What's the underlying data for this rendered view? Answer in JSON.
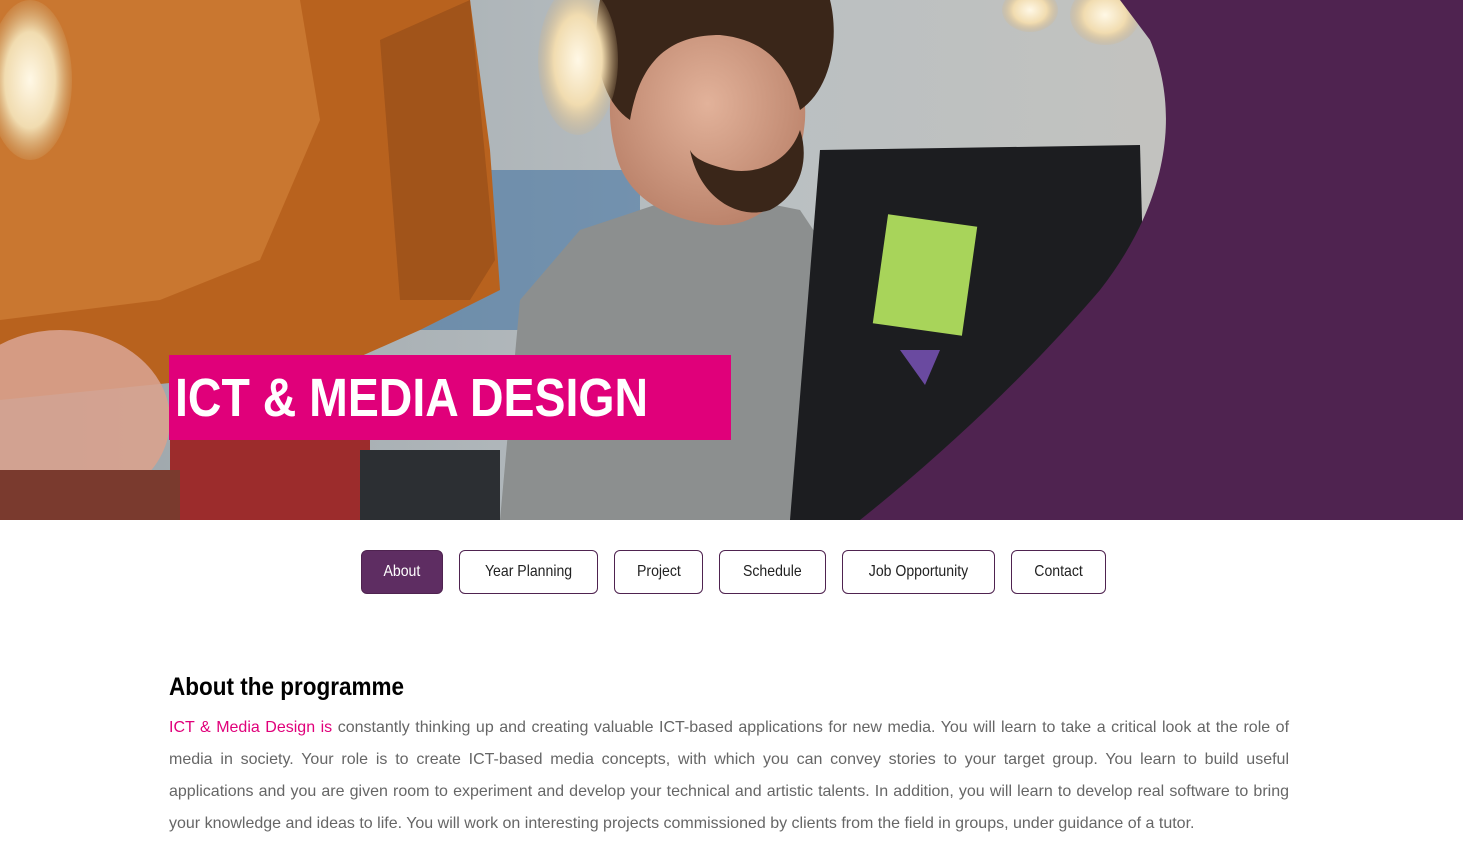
{
  "colors": {
    "accent_pink": "#e0007a",
    "brand_purple": "#4f2350",
    "tab_active_bg": "#5e2d62",
    "body_text": "#666666"
  },
  "hero": {
    "title": "ICT & MEDIA DESIGN",
    "image_alt": "Two people working at a computer"
  },
  "tabs": [
    {
      "label": "About",
      "active": true
    },
    {
      "label": "Year Planning",
      "active": false
    },
    {
      "label": "Project",
      "active": false
    },
    {
      "label": "Schedule",
      "active": false
    },
    {
      "label": "Job Opportunity",
      "active": false
    },
    {
      "label": "Contact",
      "active": false
    }
  ],
  "about": {
    "heading": "About the programme",
    "lead": "ICT & Media Design is",
    "body": " constantly thinking up and creating valuable ICT-based applications for new media. You will learn to take a critical look at the role of media in society. Your role is to create ICT-based media concepts, with which you can convey stories to your target group. You learn to build useful applications and you are given room to experiment and develop your technical and artistic talents. In addition, you will learn to develop real software to bring your knowledge and ideas to life. You will work on interesting projects commissioned by clients from the field in groups, under guidance of a tutor."
  }
}
